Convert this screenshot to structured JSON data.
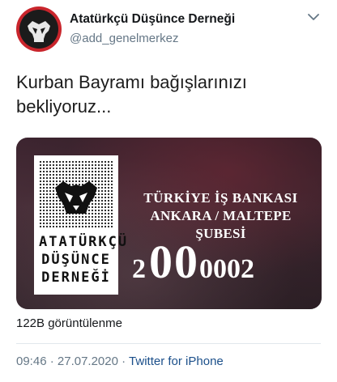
{
  "tweet": {
    "author_name": "Atatürkçü Düşünce Derneği",
    "author_handle": "@add_genelmerkez",
    "text": "Kurban Bayramı bağışlarınızı bekliyoruz...",
    "views": "122B görüntülenme",
    "time": "09:46",
    "separator": "·",
    "date": "27.07.2020",
    "source": "Twitter for iPhone"
  },
  "media": {
    "logo_lines": [
      "ATATÜRKÇÜ",
      "DÜŞÜNCE",
      "DERNEĞİ"
    ],
    "bank_line1": "TÜRKİYE İŞ BANKASI",
    "bank_line2": "ANKARA / MALTEPE ŞUBESİ",
    "account_parts": [
      "2",
      "0",
      "0",
      "0002"
    ]
  },
  "colors": {
    "accent_link": "#1b4f8a",
    "avatar_ring": "#c9252c",
    "secondary_text": "#657786"
  },
  "icons": {
    "menu": "chevron-down-icon",
    "avatar": "association-emblem"
  }
}
